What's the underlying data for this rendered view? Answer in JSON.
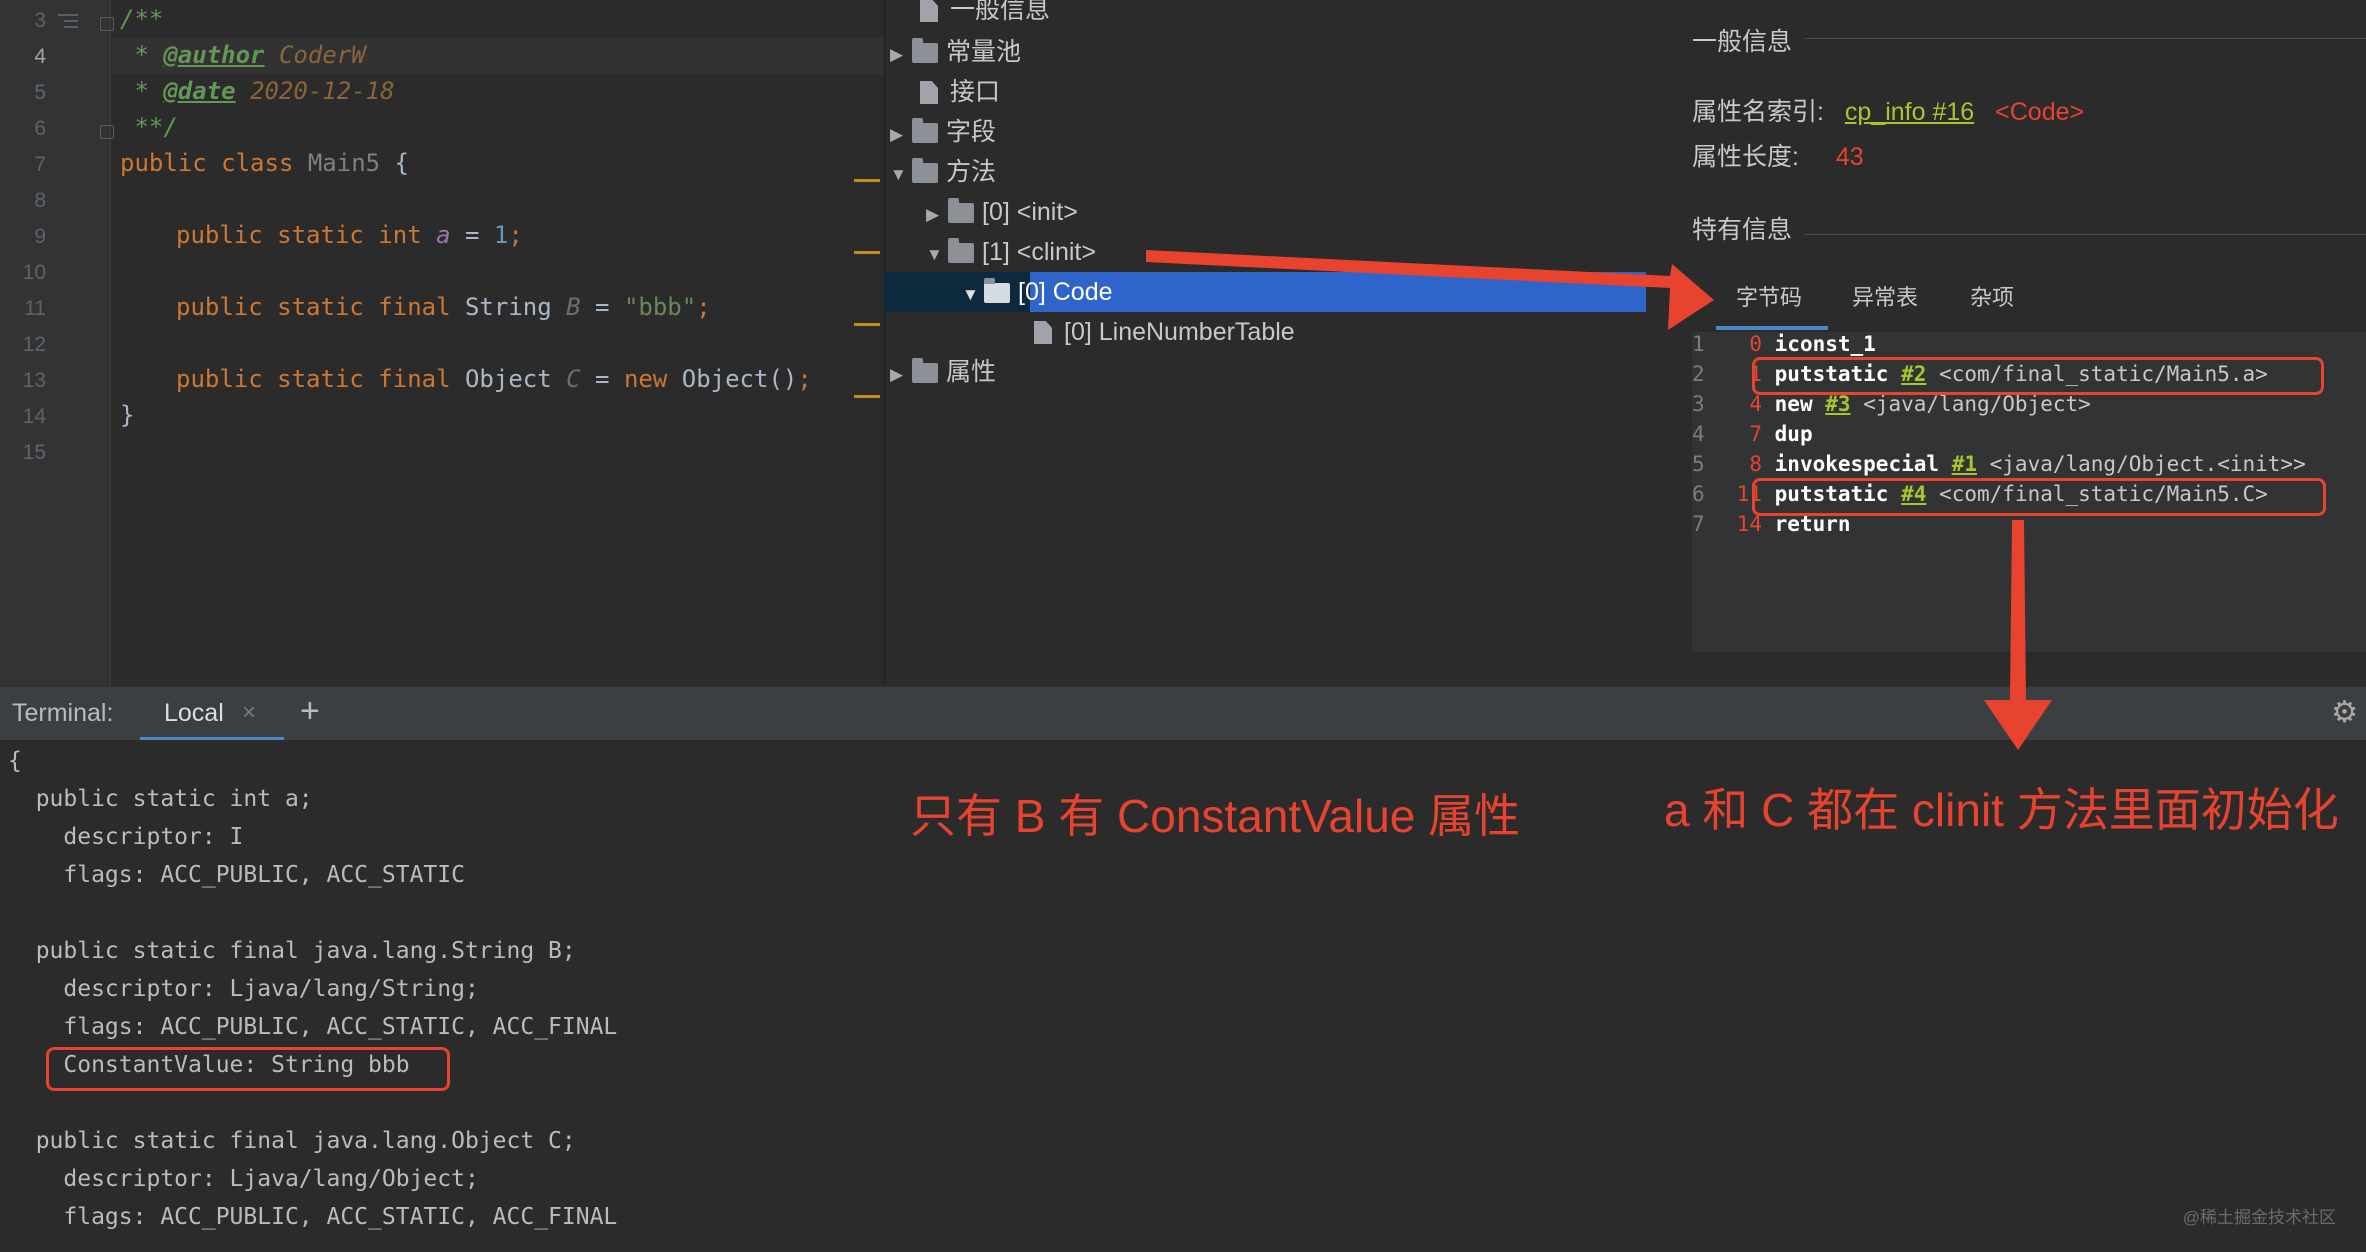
{
  "editor": {
    "line_numbers": [
      "3",
      "4",
      "5",
      "6",
      "7",
      "8",
      "9",
      "10",
      "11",
      "12",
      "13",
      "14",
      "15"
    ],
    "comment_open": "/**",
    "author_prefix": " * ",
    "author_tag": "@author",
    "author_value": "CoderW",
    "date_prefix": " * ",
    "date_tag": "@date",
    "date_value": "2020-12-18",
    "comment_close": " **/",
    "class_kw": "public class ",
    "class_name": "Main5",
    "class_brace": " {",
    "line_a": {
      "kw": "public static int ",
      "name": "a",
      "eq": " = ",
      "val": "1",
      "end": ";"
    },
    "line_b": {
      "kw": "public static final ",
      "type": "String ",
      "name": "B",
      "eq": " = ",
      "val": "\"bbb\"",
      "end": ";"
    },
    "line_c": {
      "kw": "public static final ",
      "type": "Object ",
      "name": "C",
      "eq": " = ",
      "new_kw": "new ",
      "ctor": "Object()",
      "end": ";"
    },
    "close_brace": "}"
  },
  "tree": {
    "items": [
      {
        "label": "一般信息"
      },
      {
        "label": "常量池"
      },
      {
        "label": "接口"
      },
      {
        "label": "字段"
      },
      {
        "label": "方法"
      },
      {
        "label": "[0] <init>"
      },
      {
        "label": "[1] <clinit>"
      },
      {
        "label": "[0] Code"
      },
      {
        "label": "[0] LineNumberTable"
      },
      {
        "label": "属性"
      }
    ]
  },
  "general": {
    "section_title": "一般信息",
    "attr_name_label": "属性名索引:",
    "attr_name_link": "cp_info #16",
    "attr_name_value": "<Code>",
    "attr_len_label": "属性长度:",
    "attr_len_value": "43",
    "specific_title": "特有信息"
  },
  "tabs": [
    "字节码",
    "异常表",
    "杂项"
  ],
  "bytecode": [
    {
      "n": "1",
      "off": "0",
      "op": "iconst_1",
      "ref": "",
      "arg": ""
    },
    {
      "n": "2",
      "off": "1",
      "op": "putstatic",
      "ref": "#2",
      "arg": "<com/final_static/Main5.a>"
    },
    {
      "n": "3",
      "off": "4",
      "op": "new",
      "ref": "#3",
      "arg": "<java/lang/Object>"
    },
    {
      "n": "4",
      "off": "7",
      "op": "dup",
      "ref": "",
      "arg": ""
    },
    {
      "n": "5",
      "off": "8",
      "op": "invokespecial",
      "ref": "#1",
      "arg": "<java/lang/Object.<init>>"
    },
    {
      "n": "6",
      "off": "11",
      "op": "putstatic",
      "ref": "#4",
      "arg": "<com/final_static/Main5.C>"
    },
    {
      "n": "7",
      "off": "14",
      "op": "return",
      "ref": "",
      "arg": ""
    }
  ],
  "terminal": {
    "label": "Terminal:",
    "tab": "Local",
    "close": "×",
    "add": "+",
    "settings_icon": "gear-icon",
    "lines": [
      "{",
      "  public static int a;",
      "    descriptor: I",
      "    flags: ACC_PUBLIC, ACC_STATIC",
      "",
      "  public static final java.lang.String B;",
      "    descriptor: Ljava/lang/String;",
      "    flags: ACC_PUBLIC, ACC_STATIC, ACC_FINAL",
      "    ConstantValue: String bbb",
      "",
      "  public static final java.lang.Object C;",
      "    descriptor: Ljava/lang/Object;",
      "    flags: ACC_PUBLIC, ACC_STATIC, ACC_FINAL"
    ]
  },
  "annotations": {
    "left": "只有 B 有 ConstantValue 属性",
    "right": "a 和 C 都在 clinit 方法里面初始化"
  },
  "watermark": "@稀土掘金技术社区",
  "colors": {
    "annotation_red": "#e8432e",
    "selection_blue": "#2f65ca",
    "link_green": "#a7c62b"
  }
}
